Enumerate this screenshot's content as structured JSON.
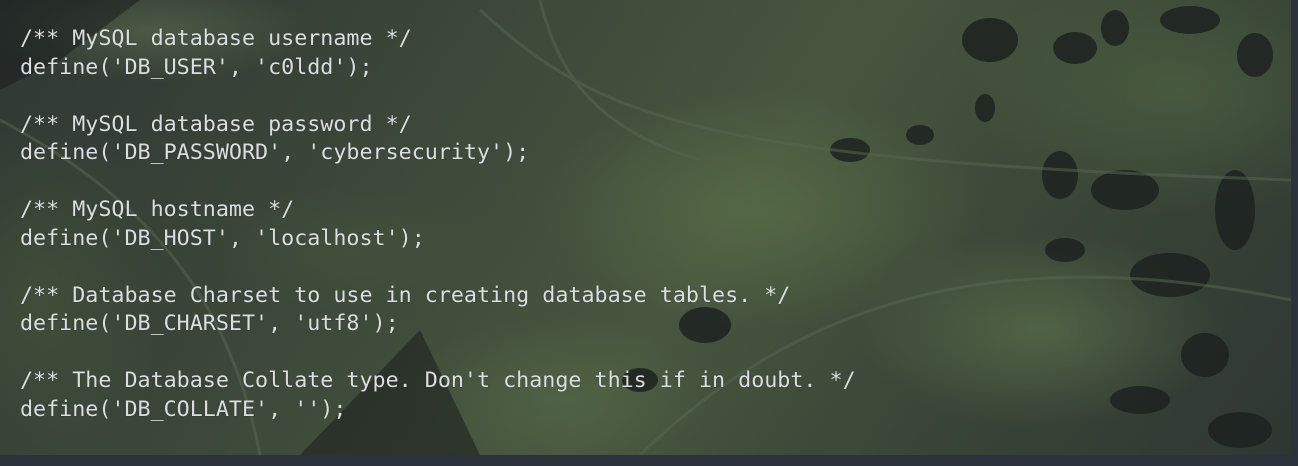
{
  "terminal": {
    "lines": [
      "/** MySQL database username */",
      "define('DB_USER', 'c0ldd');",
      "",
      "/** MySQL database password */",
      "define('DB_PASSWORD', 'cybersecurity');",
      "",
      "/** MySQL hostname */",
      "define('DB_HOST', 'localhost');",
      "",
      "/** Database Charset to use in creating database tables. */",
      "define('DB_CHARSET', 'utf8');",
      "",
      "/** The Database Collate type. Don't change this if in doubt. */",
      "define('DB_COLLATE', '');"
    ]
  },
  "colors": {
    "text": "#dcdfe2",
    "frame": "#2c323c",
    "background": "#3e4a3a"
  }
}
